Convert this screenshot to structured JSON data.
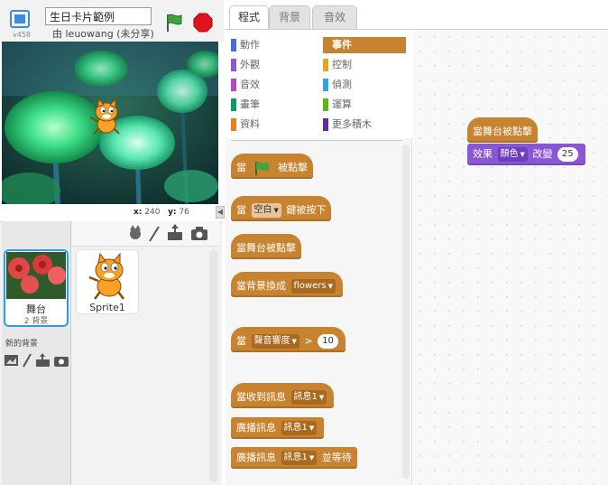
{
  "header": {
    "version": "v458",
    "project_title": "生日卡片範例",
    "author_line": "由 leuowang (未分享)"
  },
  "stage": {
    "coords_x_label": "x:",
    "coords_x": "240",
    "coords_y_label": "y:",
    "coords_y": "76"
  },
  "sprites": {
    "stage_label": "舞台",
    "stage_backdrop_count": "2 背景",
    "new_backdrop_label": "新的背景",
    "sprite1_name": "Sprite1"
  },
  "tabs": [
    {
      "label": "程式"
    },
    {
      "label": "背景"
    },
    {
      "label": "音效"
    }
  ],
  "categories": [
    {
      "label": "動作",
      "color": "#4a6cd4"
    },
    {
      "label": "事件",
      "color": "#c88330"
    },
    {
      "label": "外觀",
      "color": "#8a55d7"
    },
    {
      "label": "控制",
      "color": "#e1a91a"
    },
    {
      "label": "音效",
      "color": "#bb42c3"
    },
    {
      "label": "偵測",
      "color": "#2ca5e2"
    },
    {
      "label": "畫筆",
      "color": "#0e9a6c"
    },
    {
      "label": "運算",
      "color": "#5cb712"
    },
    {
      "label": "資料",
      "color": "#ee7d16"
    },
    {
      "label": "更多積木",
      "color": "#632d99"
    }
  ],
  "palette_blocks": {
    "flag_pre": "當",
    "flag_post": "被點擊",
    "key_pre": "當",
    "key_dd": "空白",
    "key_post": "鍵被按下",
    "stage_clicked": "當舞台被點擊",
    "bg_pre": "當背景換成",
    "bg_dd": "flowers",
    "loud_pre": "當",
    "loud_dd": "聲音響度",
    "loud_op": ">",
    "loud_val": "10",
    "recv_pre": "當收到訊息",
    "recv_dd": "訊息1",
    "bcast_pre": "廣播訊息",
    "bcast_dd": "訊息1",
    "bcastw_pre": "廣播訊息",
    "bcastw_dd": "訊息1",
    "bcastw_post": "並等待"
  },
  "script": {
    "hat_label": "當舞台被點擊",
    "effect_pre": "效果",
    "effect_dd": "顏色",
    "effect_mid": "改變",
    "effect_val": "25"
  }
}
